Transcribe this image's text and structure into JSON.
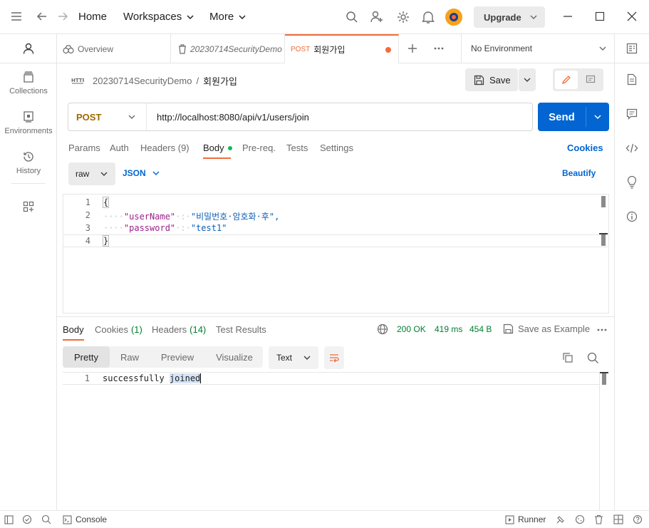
{
  "topbar": {
    "home": "Home",
    "workspaces": "Workspaces",
    "more": "More",
    "upgrade": "Upgrade"
  },
  "sidebar": {
    "items": [
      {
        "label": "Collections",
        "icon": "collections-icon"
      },
      {
        "label": "Environments",
        "icon": "environments-icon"
      },
      {
        "label": "History",
        "icon": "history-icon"
      }
    ]
  },
  "tabs": {
    "overview": "Overview",
    "collection": "20230714SecurityDemo",
    "active_method": "POST",
    "active_name": "회원가입",
    "environment": "No Environment"
  },
  "breadcrumb": {
    "collection": "20230714SecurityDemo",
    "separator": "/",
    "request": "회원가입"
  },
  "toolbar": {
    "save": "Save"
  },
  "request": {
    "method": "POST",
    "url": "http://localhost:8080/api/v1/users/join",
    "send": "Send",
    "tabs": {
      "params": "Params",
      "auth": "Auth",
      "headers": "Headers (9)",
      "body": "Body",
      "prereq": "Pre-req.",
      "tests": "Tests",
      "settings": "Settings"
    },
    "cookies": "Cookies",
    "body_mode": "raw",
    "body_lang": "JSON",
    "beautify": "Beautify"
  },
  "editor": {
    "lines": [
      "1",
      "2",
      "3",
      "4"
    ],
    "open_brace": "{",
    "close_brace": "}",
    "indent": "····",
    "key1": "\"userName\"",
    "value1": "\"비밀번호·암호화·후\",",
    "key2": "\"password\"",
    "value2": "\"test1\"",
    "colon": "·:·"
  },
  "response": {
    "tabs": {
      "body": "Body",
      "cookies": "Cookies",
      "cookies_count": "(1)",
      "headers": "Headers",
      "headers_count": "(14)",
      "tests": "Test Results"
    },
    "status": "200 OK",
    "time": "419 ms",
    "size": "454 B",
    "save_example": "Save as Example",
    "views": [
      "Pretty",
      "Raw",
      "Preview",
      "Visualize"
    ],
    "format": "Text",
    "line_num": "1",
    "body_text_1": "successfully",
    "body_text_2": "joined"
  },
  "statusbar": {
    "console": "Console",
    "runner": "Runner"
  },
  "colors": {
    "accent": "#f26b3a",
    "send": "#0265d2",
    "link": "#0265d2",
    "status_ok": "#007f31"
  }
}
